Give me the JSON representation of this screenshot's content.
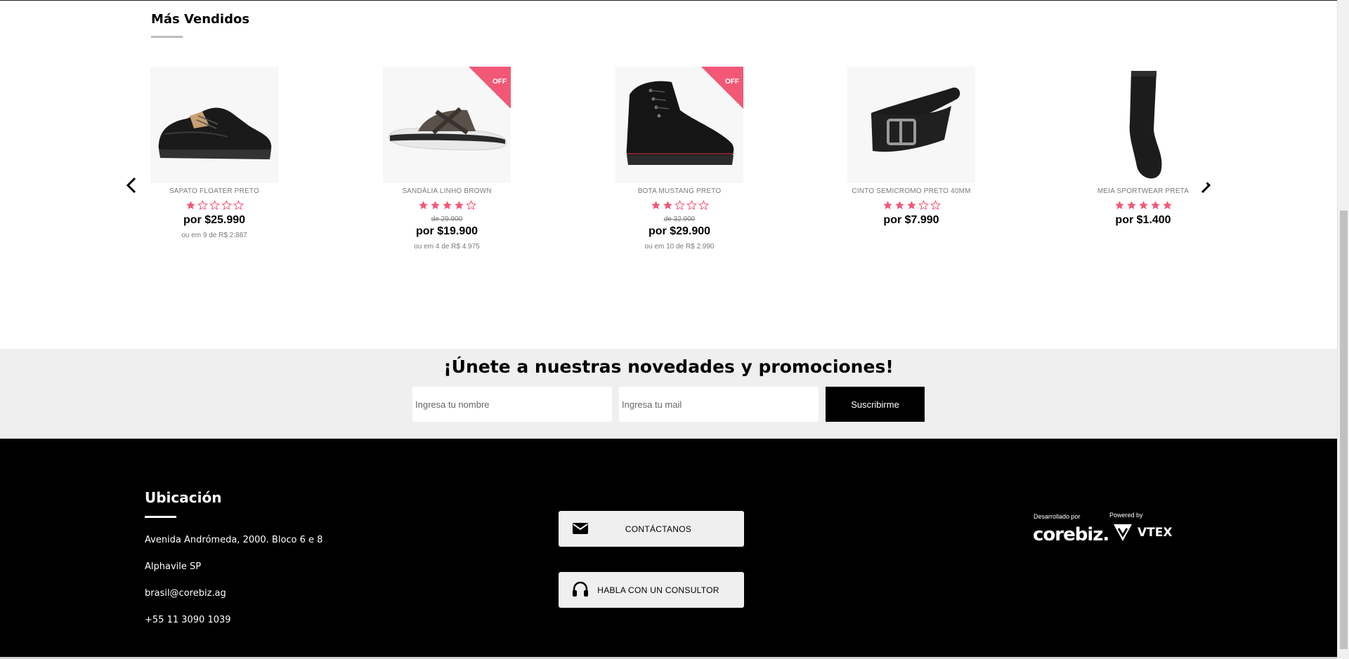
{
  "best_sellers": {
    "title": "Más Vendidos",
    "products": [
      {
        "name": "SAPATO FLOATER PRETO",
        "rating": 1,
        "old_price": "",
        "price": "por $25.990",
        "installments": "ou em 9 de R$ 2.887",
        "badge": ""
      },
      {
        "name": "SANDÁLIA LINHO BROWN",
        "rating": 4,
        "old_price": "de 29.900",
        "price": "por $19.900",
        "installments": "ou em 4 de R$ 4.975",
        "badge": "OFF"
      },
      {
        "name": "BOTA MUSTANG PRETO",
        "rating": 2,
        "old_price": "de 32.900",
        "price": "por $29.900",
        "installments": "ou em 10 de R$ 2.990",
        "badge": "OFF"
      },
      {
        "name": "CINTO SEMICROMO PRETO 40MM",
        "rating": 3,
        "old_price": "",
        "price": "por $7.990",
        "installments": "",
        "badge": ""
      },
      {
        "name": "MEIA SPORTWEAR PRETA",
        "rating": 5,
        "old_price": "",
        "price": "por $1.400",
        "installments": "",
        "badge": ""
      }
    ]
  },
  "newsletter": {
    "title": "¡Únete a nuestras novedades y promociones!",
    "name_placeholder": "Ingresa tu nombre",
    "mail_placeholder": "Ingresa tu mail",
    "submit_label": "Suscribirme"
  },
  "footer": {
    "location_heading": "Ubicación",
    "address": "Avenida Andrómeda, 2000. Bloco 6 e 8",
    "city": "Alphavile SP",
    "email": "brasil@corebiz.ag",
    "phone": "+55 11 3090 1039",
    "contact_label": "CONTÁCTANOS",
    "consultant_label": "HABLA CON UN CONSULTOR",
    "developed_by_label": "Desarrollado por",
    "developer_logo": "corebiz.",
    "powered_by_label": "Powered by",
    "platform_logo": "VTEX"
  },
  "colors": {
    "star": "#f25876",
    "badge": "#f25876",
    "footer_bg": "#000000",
    "newsletter_bg": "#efefef"
  }
}
